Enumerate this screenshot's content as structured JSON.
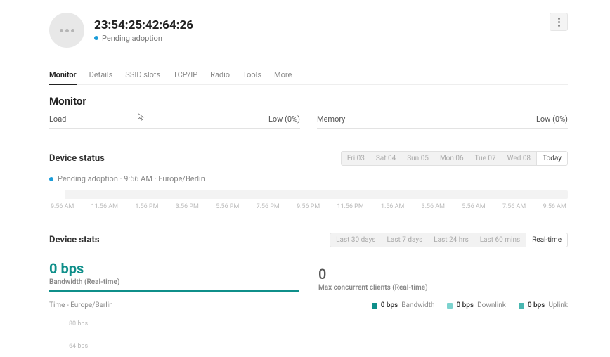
{
  "header": {
    "device_id": "23:54:25:42:64:26",
    "status_text": "Pending adoption"
  },
  "tabs": [
    "Monitor",
    "Details",
    "SSID slots",
    "TCP/IP",
    "Radio",
    "Tools",
    "More"
  ],
  "monitor": {
    "section_title": "Monitor",
    "load": {
      "label": "Load",
      "value": "Low (0%)"
    },
    "memory": {
      "label": "Memory",
      "value": "Low (0%)"
    }
  },
  "device_status": {
    "title": "Device status",
    "days": [
      "Fri 03",
      "Sat 04",
      "Sun 05",
      "Mon 06",
      "Tue 07",
      "Wed 08",
      "Today"
    ],
    "event_text": "Pending adoption · 9:56 AM · Europe/Berlin",
    "time_axis": [
      "9:56 AM",
      "11:56 AM",
      "1:56 PM",
      "3:56 PM",
      "5:56 PM",
      "7:56 PM",
      "9:56 PM",
      "11:56 PM",
      "1:56 AM",
      "3:56 AM",
      "5:56 AM",
      "7:56 AM",
      "9:56 AM"
    ]
  },
  "device_stats": {
    "title": "Device stats",
    "ranges": [
      "Last 30 days",
      "Last 7 days",
      "Last 24 hrs",
      "Last 60 mins",
      "Real-time"
    ],
    "bandwidth": {
      "value": "0 bps",
      "label": "Bandwidth (Real-time)"
    },
    "clients": {
      "value": "0",
      "label": "Max concurrent clients (Real-time)"
    },
    "time_label": "Time - Europe/Berlin",
    "legend": {
      "bandwidth": {
        "value": "0 bps",
        "label": "Bandwidth",
        "color": "#0f8f8a"
      },
      "downlink": {
        "value": "0 bps",
        "label": "Downlink",
        "color": "#7cd3cf"
      },
      "uplink": {
        "value": "0 bps",
        "label": "Uplink",
        "color": "#49b7b1"
      }
    },
    "y_ticks": [
      "80 bps",
      "64 bps"
    ]
  },
  "chart_data": [
    {
      "type": "line",
      "title": "Bandwidth (Real-time)",
      "xlabel": "Time - Europe/Berlin",
      "ylabel": "bps",
      "ylim": [
        0,
        80
      ],
      "y_ticks": [
        80,
        64
      ],
      "series": [
        {
          "name": "Bandwidth",
          "values": []
        },
        {
          "name": "Downlink",
          "values": []
        },
        {
          "name": "Uplink",
          "values": []
        }
      ]
    }
  ]
}
